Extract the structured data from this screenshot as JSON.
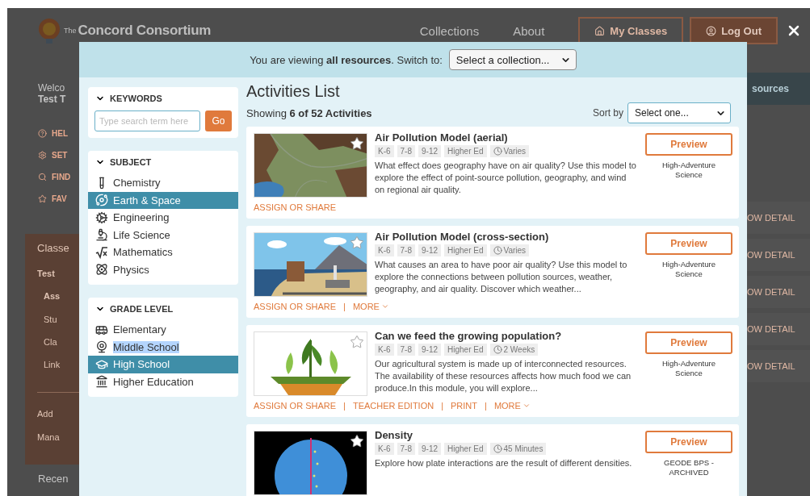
{
  "background_page": {
    "logo": {
      "prefix": "The",
      "name": "Concord Consortium"
    },
    "nav": [
      "Collections",
      "About"
    ],
    "buttons": [
      {
        "label": "My Classes",
        "kind": "outline"
      },
      {
        "label": "Log Out",
        "kind": "filled"
      }
    ],
    "welcome": {
      "greeting": "Welco",
      "name": "Test T"
    },
    "menu": [
      "HEL",
      "SET",
      "FIND",
      "FAV"
    ],
    "classes_panel": {
      "title": "Classe",
      "items": [
        {
          "text": "Test",
          "bold": true
        },
        {
          "text": "Ass",
          "bold": true
        },
        {
          "text": "Stu",
          "bold": false
        },
        {
          "text": "Cla",
          "bold": false
        },
        {
          "text": "Link",
          "bold": false
        }
      ],
      "actions": [
        "Add",
        "Mana"
      ]
    },
    "recent": "Recen",
    "side_button": "sources",
    "detail_links": [
      "OW DETAIL",
      "OW DETAIL",
      "OW DETAIL",
      "OW DETAIL",
      "OW DETAIL"
    ]
  },
  "modal": {
    "banner": {
      "text": "You are viewing **all resources**. Switch to:",
      "select": "Select a collection..."
    },
    "filters": {
      "keywords": {
        "title": "KEYWORDS",
        "placeholder": "Type search term here",
        "button": "Go"
      },
      "subject": {
        "title": "SUBJECT",
        "items": [
          {
            "label": "Chemistry",
            "selected": false
          },
          {
            "label": "Earth & Space",
            "selected": true
          },
          {
            "label": "Engineering",
            "selected": false
          },
          {
            "label": "Life Science",
            "selected": false
          },
          {
            "label": "Mathematics",
            "selected": false
          },
          {
            "label": "Physics",
            "selected": false
          }
        ]
      },
      "grade_level": {
        "title": "GRADE LEVEL",
        "items": [
          {
            "label": "Elementary",
            "selected": false,
            "text_highlighted": false
          },
          {
            "label": "Middle School",
            "selected": false,
            "text_highlighted": true
          },
          {
            "label": "High School",
            "selected": true,
            "text_highlighted": false
          },
          {
            "label": "Higher Education",
            "selected": false,
            "text_highlighted": false
          }
        ]
      }
    },
    "list": {
      "title": "Activities List",
      "count": "Showing **6 of 52 Activities**",
      "sort_label": "Sort by",
      "sort_value": "Select one...",
      "activities": [
        {
          "title": "Air Pollution Model (aerial)",
          "tags": [
            "K-6",
            "7-8",
            "9-12",
            "Higher Ed"
          ],
          "duration": "Varies",
          "description": "What effect does geography have on air quality? Use this model to explore the effect of point-source pollution, geography, and wind on regional air quality.",
          "actions": [
            {
              "label": "ASSIGN OR SHARE",
              "kind": "link"
            }
          ],
          "preview": "Preview",
          "publisher": "High-Adventure Science"
        },
        {
          "title": "Air Pollution Model (cross-section)",
          "tags": [
            "K-6",
            "7-8",
            "9-12",
            "Higher Ed"
          ],
          "duration": "Varies",
          "description": "What causes an area to have poor air quality? Use this model to explore the connections between pollution sources, weather, geography, and air quality. Discover which weather...",
          "actions": [
            {
              "label": "ASSIGN OR SHARE",
              "kind": "link"
            },
            {
              "label": "|",
              "kind": "separator"
            },
            {
              "label": "MORE",
              "kind": "more"
            }
          ],
          "preview": "Preview",
          "publisher": "High-Adventure Science"
        },
        {
          "title": "Can we feed the growing population?",
          "tags": [
            "K-6",
            "7-8",
            "9-12",
            "Higher Ed"
          ],
          "duration": "2 Weeks",
          "description": "Our agricultural system is made up of interconnected resources. The availability of these resources affects how much food we can produce.In this module, you will explore...",
          "actions": [
            {
              "label": "ASSIGN OR SHARE",
              "kind": "link"
            },
            {
              "label": "|",
              "kind": "separator"
            },
            {
              "label": "TEACHER EDITION",
              "kind": "link"
            },
            {
              "label": "|",
              "kind": "separator"
            },
            {
              "label": "PRINT",
              "kind": "link"
            },
            {
              "label": "|",
              "kind": "separator"
            },
            {
              "label": "MORE",
              "kind": "more"
            }
          ],
          "preview": "Preview",
          "publisher": "High-Adventure Science"
        },
        {
          "title": "Density",
          "tags": [
            "K-6",
            "7-8",
            "9-12",
            "Higher Ed"
          ],
          "duration": "45 Minutes",
          "description": "Explore how plate interactions are the result of different densities.",
          "preview": "Preview",
          "publisher": "GEODE BPS - ARCHIVED"
        }
      ]
    }
  }
}
